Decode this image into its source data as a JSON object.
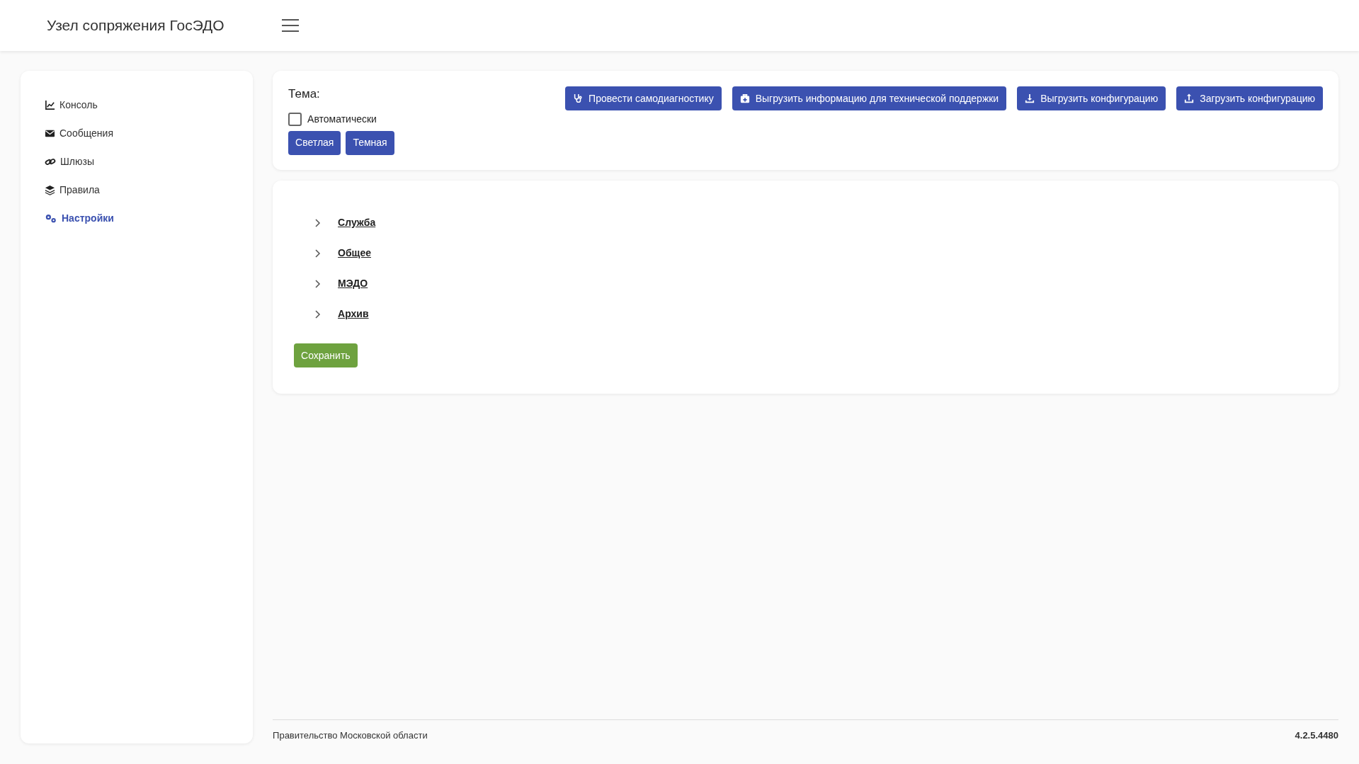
{
  "header": {
    "title": "Узел сопряжения ГосЭДО"
  },
  "sidebar": {
    "items": [
      {
        "label": "Консоль",
        "selected": false
      },
      {
        "label": "Сообщения",
        "selected": false
      },
      {
        "label": "Шлюзы",
        "selected": false
      },
      {
        "label": "Правила",
        "selected": false
      },
      {
        "label": "Настройки",
        "selected": true
      }
    ]
  },
  "theme": {
    "label": "Тема:",
    "auto": {
      "label": "Автоматически",
      "checked": false
    },
    "buttons": [
      "Светлая",
      "Темная"
    ]
  },
  "actions": [
    "Провести самодиагностику",
    "Выгрузить информацию для технической поддержки",
    "Выгрузить конфигурацию",
    "Загрузить конфигурацию"
  ],
  "sections": [
    {
      "label": "Служба",
      "expanded": false
    },
    {
      "label": "Общее",
      "expanded": false
    },
    {
      "label": "МЭДО",
      "expanded": false
    },
    {
      "label": "Архив",
      "expanded": false
    }
  ],
  "save_button": "Сохранить",
  "footer": {
    "organization": "Правительство Московской области",
    "version": "4.2.5.4480"
  }
}
